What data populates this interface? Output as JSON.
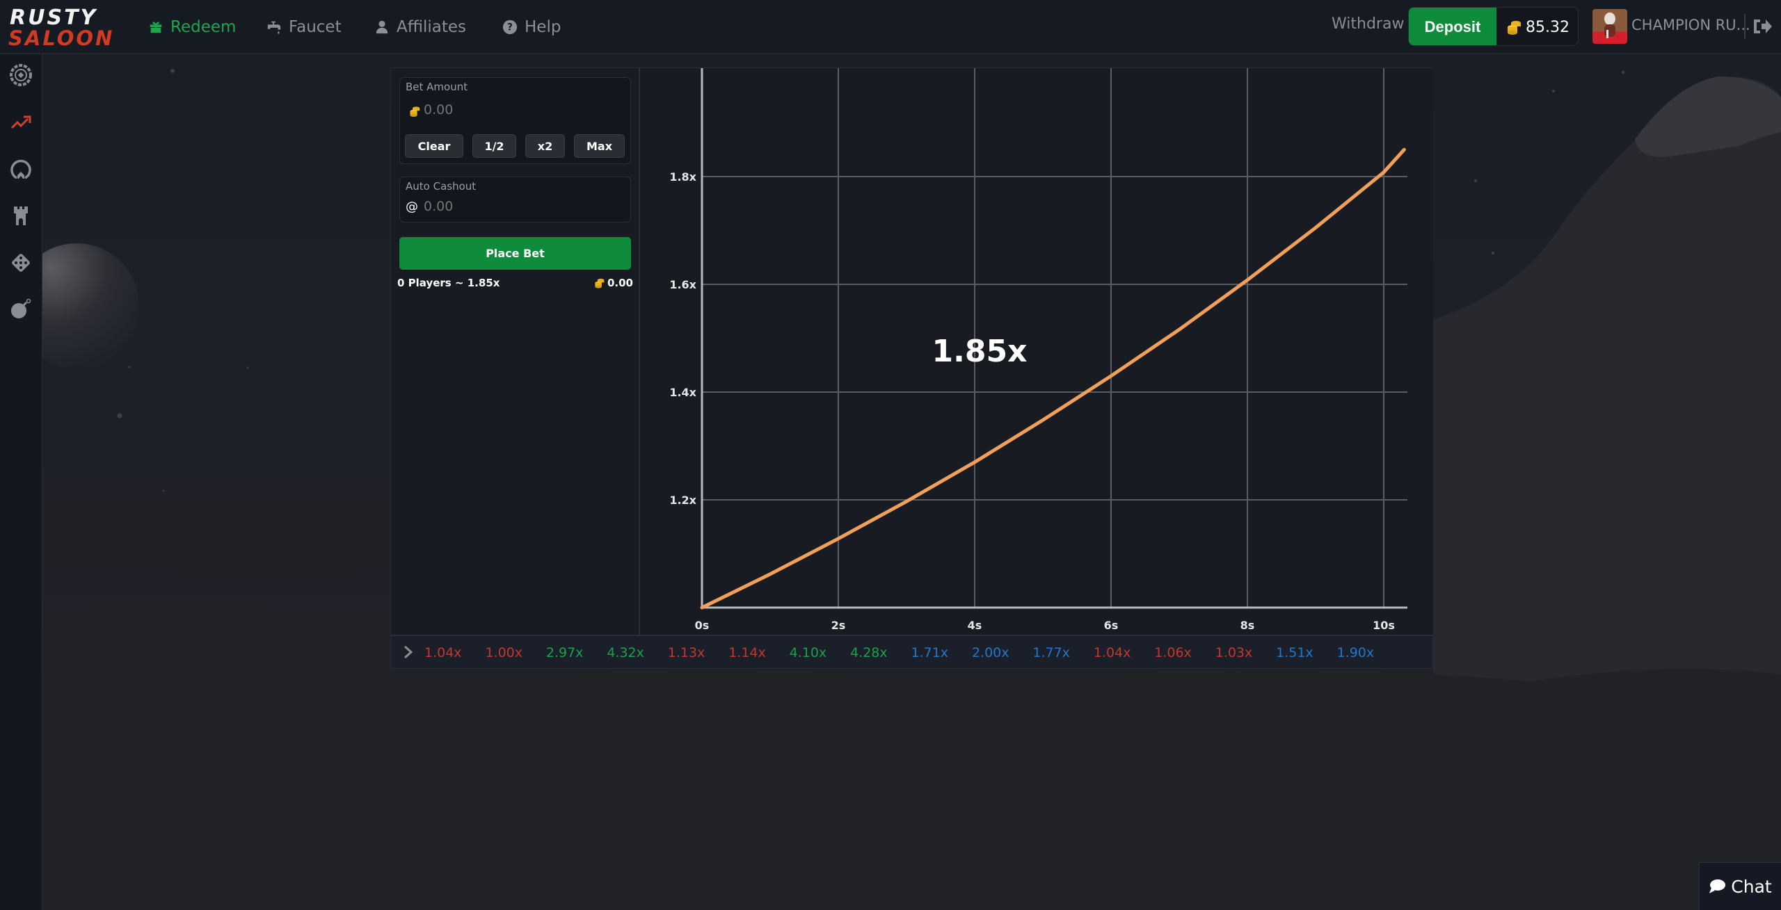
{
  "brand": {
    "line1": "RUSTY",
    "line2": "SALOON"
  },
  "nav": [
    {
      "label": "Redeem",
      "icon": "gift-icon",
      "active": true
    },
    {
      "label": "Faucet",
      "icon": "faucet-icon",
      "active": false
    },
    {
      "label": "Affiliates",
      "icon": "user-icon",
      "active": false
    },
    {
      "label": "Help",
      "icon": "question-circle-icon",
      "active": false
    }
  ],
  "account": {
    "withdraw_label": "Withdraw",
    "deposit_label": "Deposit",
    "balance": "85.32",
    "username": "CHAMPION RU..."
  },
  "sidebar": {
    "items": [
      {
        "name": "roulette",
        "icon": "roulette-wheel-icon",
        "active": false
      },
      {
        "name": "crash",
        "icon": "trending-up-icon",
        "active": true
      },
      {
        "name": "wheel",
        "icon": "wheel-icon",
        "active": false
      },
      {
        "name": "towers",
        "icon": "castle-tower-icon",
        "active": false
      },
      {
        "name": "dice",
        "icon": "dice-icon",
        "active": false
      },
      {
        "name": "mines",
        "icon": "bomb-icon",
        "active": false
      }
    ]
  },
  "bet": {
    "bet_amount_label": "Bet Amount",
    "bet_amount_placeholder": "0.00",
    "buttons": {
      "clear": "Clear",
      "half": "1/2",
      "double": "x2",
      "max": "Max"
    },
    "auto_cashout_label": "Auto Cashout",
    "auto_cashout_prefix": "@",
    "auto_cashout_placeholder": "0.00",
    "place_bet_label": "Place Bet",
    "players_summary": "0 Players ~ 1.85x",
    "pot_total": "0.00"
  },
  "game": {
    "current_multiplier": "1.85x",
    "history": [
      {
        "value": "1.04x",
        "tier": "low"
      },
      {
        "value": "1.00x",
        "tier": "low"
      },
      {
        "value": "2.97x",
        "tier": "high"
      },
      {
        "value": "4.32x",
        "tier": "high"
      },
      {
        "value": "1.13x",
        "tier": "low"
      },
      {
        "value": "1.14x",
        "tier": "low"
      },
      {
        "value": "4.10x",
        "tier": "high"
      },
      {
        "value": "4.28x",
        "tier": "high"
      },
      {
        "value": "1.71x",
        "tier": "mid"
      },
      {
        "value": "2.00x",
        "tier": "mid"
      },
      {
        "value": "1.77x",
        "tier": "mid"
      },
      {
        "value": "1.04x",
        "tier": "low"
      },
      {
        "value": "1.06x",
        "tier": "low"
      },
      {
        "value": "1.03x",
        "tier": "low"
      },
      {
        "value": "1.51x",
        "tier": "mid"
      },
      {
        "value": "1.90x",
        "tier": "mid"
      }
    ],
    "tier_colors": {
      "low": "#c0392b",
      "mid": "#1f78c8",
      "high": "#16a34a"
    }
  },
  "chart_data": {
    "type": "line",
    "title": "1.85x",
    "xlabel": "",
    "ylabel": "",
    "x_ticks": [
      "0s",
      "2s",
      "4s",
      "6s",
      "8s",
      "10s"
    ],
    "x_tick_values": [
      0,
      2,
      4,
      6,
      8,
      10
    ],
    "y_ticks": [
      "1.2x",
      "1.4x",
      "1.6x",
      "1.8x"
    ],
    "y_tick_values": [
      1.2,
      1.4,
      1.6,
      1.8
    ],
    "xlim": [
      0,
      10.4
    ],
    "ylim": [
      1.0,
      2.0
    ],
    "grid": true,
    "series": [
      {
        "name": "multiplier",
        "color": "#f0a058",
        "x": [
          0,
          1,
          2,
          3,
          4,
          5,
          6,
          7,
          8,
          9,
          10,
          10.3
        ],
        "y": [
          1.0,
          1.062,
          1.128,
          1.197,
          1.27,
          1.348,
          1.43,
          1.516,
          1.608,
          1.705,
          1.808,
          1.85
        ]
      }
    ]
  },
  "chat": {
    "label": "Chat"
  }
}
